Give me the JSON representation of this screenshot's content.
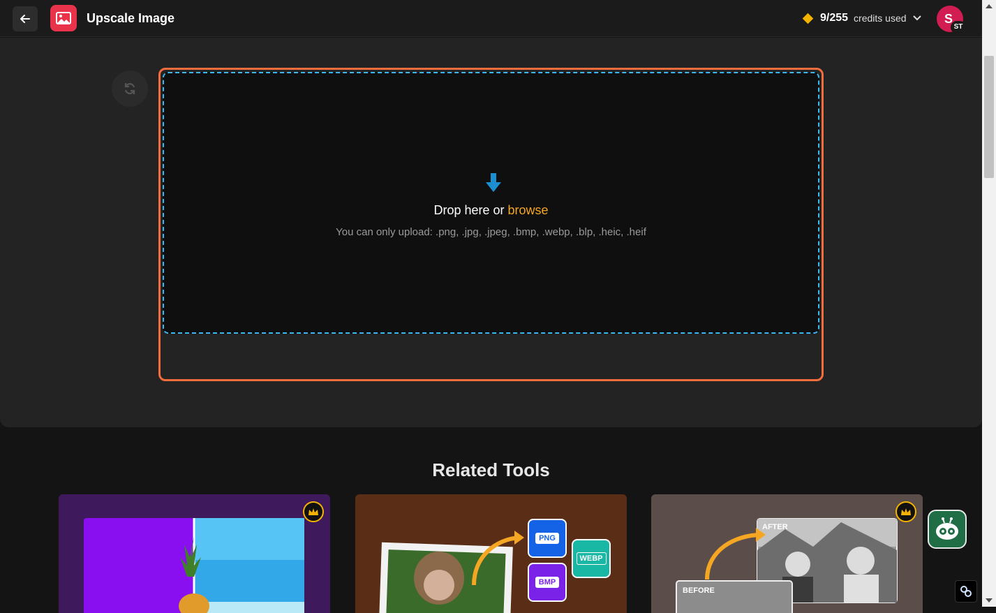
{
  "header": {
    "title": "Upscale Image",
    "credits_value": "9/255",
    "credits_label": "credits used",
    "avatar_initial": "S",
    "avatar_badge": "ST"
  },
  "upload": {
    "drop_text": "Drop here or ",
    "browse_label": "browse",
    "hint": "You can only upload: .png, .jpg, .jpeg, .bmp, .webp, .blp, .heic, .heif"
  },
  "related": {
    "title": "Related Tools",
    "cards": [
      {
        "name": "tool-card-1",
        "premium": true
      },
      {
        "name": "tool-card-2",
        "premium": false,
        "badges": [
          "PNG",
          "WEBP",
          "BMP"
        ]
      },
      {
        "name": "tool-card-3",
        "premium": true,
        "labels": [
          "AFTER",
          "BEFORE"
        ]
      }
    ]
  },
  "colors": {
    "accent_orange": "#f26d3d",
    "dashed_blue": "#39b8f2",
    "browse_link": "#f5a623",
    "app_icon": "#e8334a"
  }
}
